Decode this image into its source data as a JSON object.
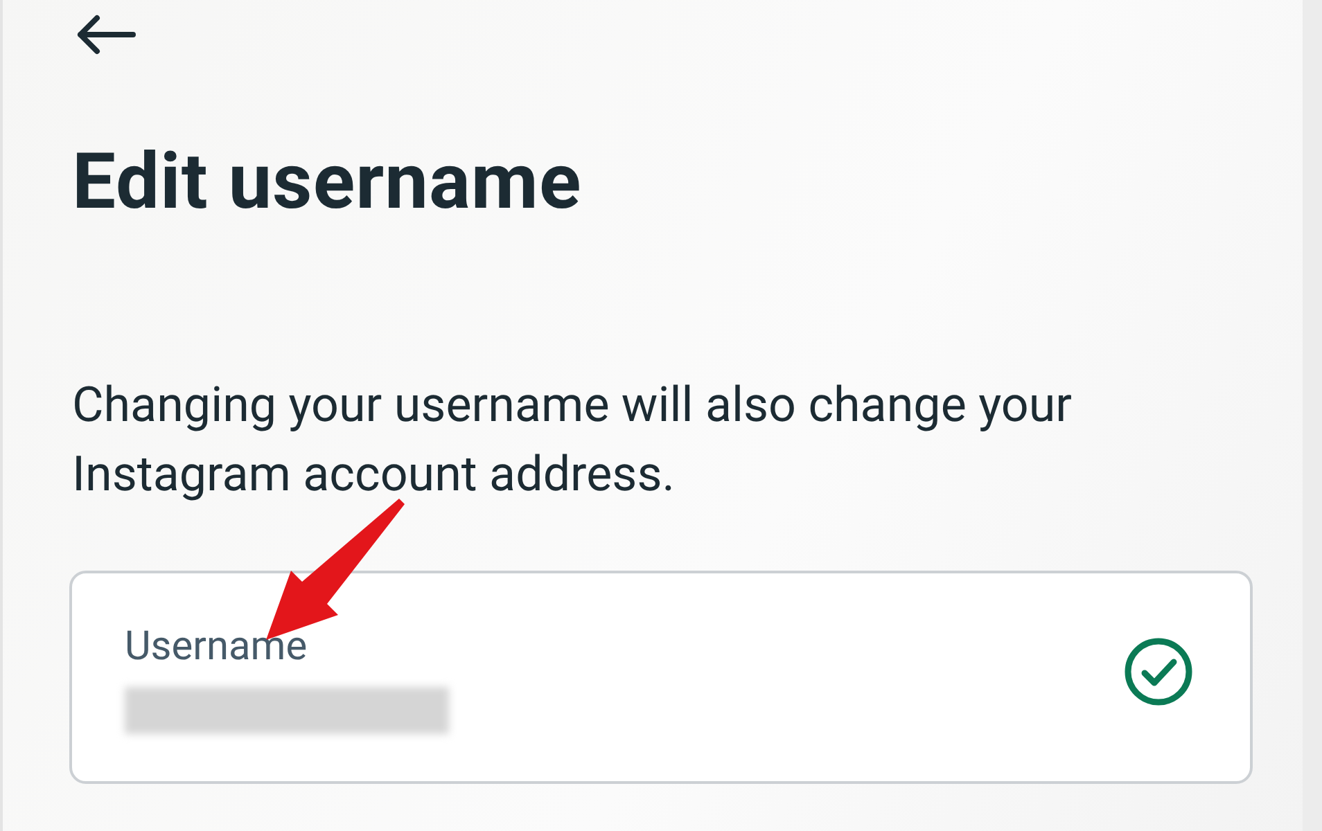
{
  "header": {
    "title": "Edit username"
  },
  "description": "Changing your username will also change your Instagram account address.",
  "field": {
    "label": "Username",
    "valid": true
  }
}
